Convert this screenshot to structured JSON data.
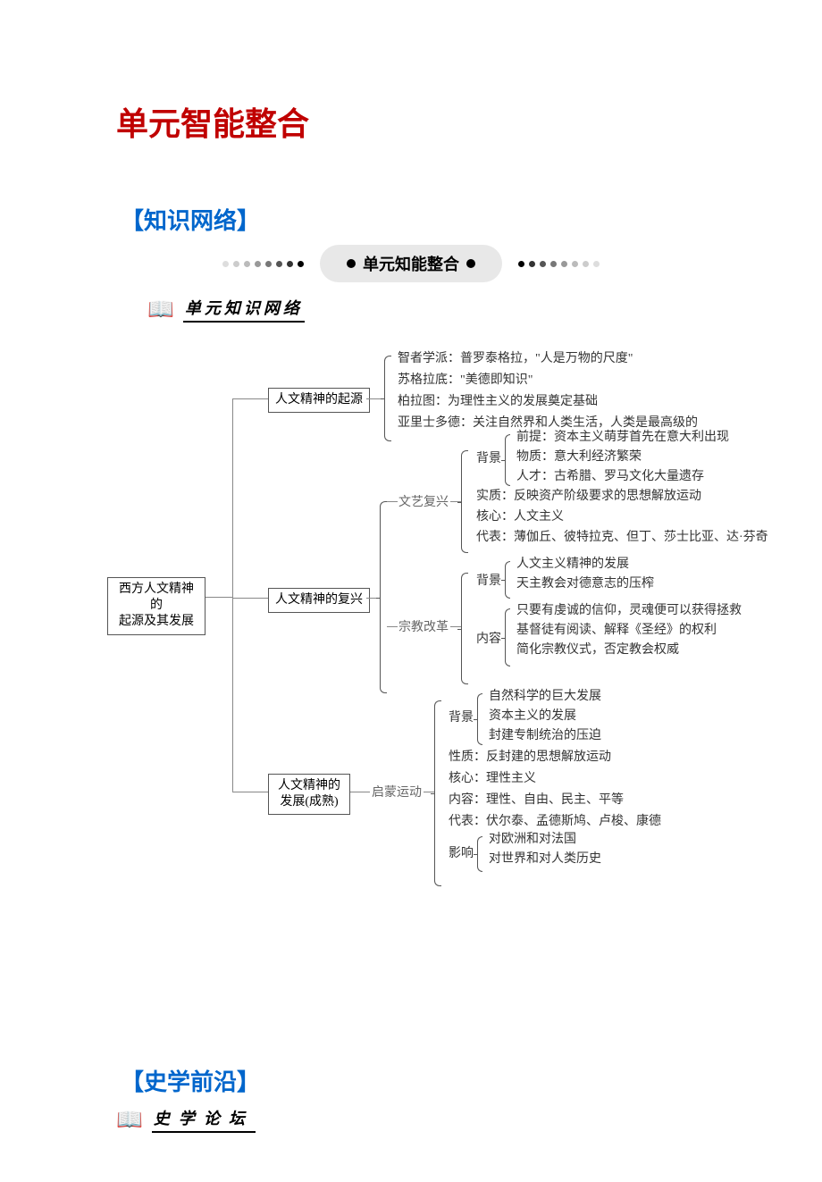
{
  "page_title": "单元智能整合",
  "knowledge_network_label": "【知识网络】",
  "banner_title": "单元知能整合",
  "sub_banner": "单元知识网络",
  "history_frontier_label": "【史学前沿】",
  "history_forum": "史学论坛",
  "root": "西方人文精神的\n起源及其发展",
  "b1": {
    "title": "人文精神的起源",
    "lines": [
      "智者学派：普罗泰格拉，\"人是万物的尺度\"",
      "苏格拉底：\"美德即知识\"",
      "柏拉图：为理性主义的发展奠定基础",
      "亚里士多德：关注自然界和人类生活，人类是最高级的"
    ]
  },
  "b2": {
    "title": "人文精神的复兴",
    "renaissance": {
      "label": "文艺复兴",
      "bg_label": "背景",
      "bg": [
        "前提：资本主义萌芽首先在意大利出现",
        "物质：意大利经济繁荣",
        "人才：古希腊、罗马文化大量遗存"
      ],
      "essence": "实质：反映资产阶级要求的思想解放运动",
      "core": "核心：人文主义",
      "reps": "代表：薄伽丘、彼特拉克、但丁、莎士比亚、达·芬奇"
    },
    "reform": {
      "label": "宗教改革",
      "bg_label": "背景",
      "bg": [
        "人文主义精神的发展",
        "天主教会对德意志的压榨"
      ],
      "content_label": "内容",
      "content": [
        "只要有虔诚的信仰，灵魂便可以获得拯救",
        "基督徒有阅读、解释《圣经》的权利",
        "简化宗教仪式，否定教会权威"
      ]
    }
  },
  "b3": {
    "title": "人文精神的\n发展(成熟)",
    "enlight": {
      "label": "启蒙运动",
      "bg_label": "背景",
      "bg": [
        "自然科学的巨大发展",
        "资本主义的发展",
        "封建专制统治的压迫"
      ],
      "nature": "性质：反封建的思想解放运动",
      "core": "核心：理性主义",
      "content": "内容：理性、自由、民主、平等",
      "reps": "代表：伏尔泰、孟德斯鸠、卢梭、康德",
      "impact_label": "影响",
      "impact": [
        "对欧洲和对法国",
        "对世界和对人类历史"
      ]
    }
  }
}
